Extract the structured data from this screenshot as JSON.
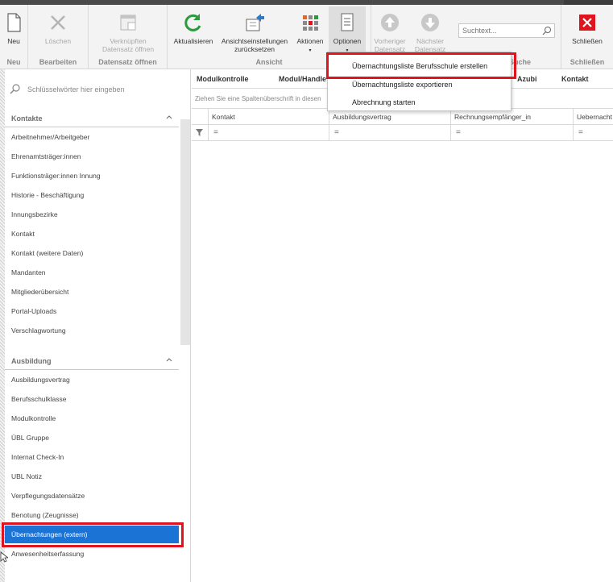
{
  "ribbon": {
    "groups": {
      "neu": "Neu",
      "bearbeiten": "Bearbeiten",
      "datensatz_oeffnen": "Datensatz öffnen",
      "ansicht": "Ansicht",
      "suche": "Suche",
      "schliessen": "Schließen"
    },
    "buttons": {
      "neu": "Neu",
      "loeschen": "Löschen",
      "verknuepften_1": "Verknüpften",
      "verknuepften_2": "Datensatz öffnen",
      "aktualisieren": "Aktualisieren",
      "ansicht_1": "Ansichtseinstellungen",
      "ansicht_2": "zurücksetzen",
      "aktionen": "Aktionen",
      "optionen": "Optionen",
      "vorheriger_1": "Vorheriger",
      "vorheriger_2": "Datensatz",
      "naechster_1": "Nächster",
      "naechster_2": "Datensatz",
      "schliessen": "Schließen"
    },
    "search_placeholder": "Suchtext..."
  },
  "options_menu": {
    "items": [
      "Übernachtungsliste Berufsschule erstellen",
      "Übernachtungsliste exportieren",
      "Abrechnung starten"
    ]
  },
  "sidebar": {
    "search_placeholder": "Schlüsselwörter hier eingeben",
    "sections": [
      {
        "title": "Kontakte",
        "items": [
          "Arbeitnehmer/Arbeitgeber",
          "Ehrenamtsträger:innen",
          "Funktionsträger:innen Innung",
          "Historie - Beschäftigung",
          "Innungsbezirke",
          "Kontakt",
          "Kontakt (weitere Daten)",
          "Mandanten",
          "Mitgliederübersicht",
          "Portal-Uploads",
          "Verschlagwortung"
        ]
      },
      {
        "title": "Ausbildung",
        "items": [
          "Ausbildungsvertrag",
          "Berufsschulklasse",
          "Modulkontrolle",
          "ÜBL Gruppe",
          "Internat Check-In",
          "UBL Notiz",
          "Verpflegungsdatensätze",
          "Benotung (Zeugnisse)",
          "Übernachtungen (extern)",
          "Anwesenheitserfassung"
        ]
      }
    ]
  },
  "grid": {
    "top_tabs": [
      "Modulkontrolle",
      "Modul/Handle",
      "Azubi",
      "Kontakt"
    ],
    "group_hint": "Ziehen Sie eine Spaltenüberschrift in diesen",
    "columns": [
      "Kontakt",
      "Ausbildungsvertrag",
      "Rechnungsempfänger_in",
      "Uebernacht"
    ],
    "filter_symbol": "="
  },
  "colors": {
    "accent_selected": "#1c73d6",
    "highlight_red": "#e0141e",
    "refresh_green": "#2a9a3c",
    "close_red": "#e0141e"
  }
}
